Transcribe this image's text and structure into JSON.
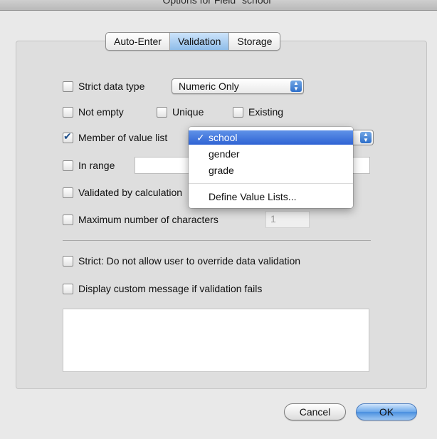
{
  "window": {
    "title": "Options for Field \"school\""
  },
  "tabs": [
    {
      "label": "Auto-Enter"
    },
    {
      "label": "Validation"
    },
    {
      "label": "Storage"
    }
  ],
  "validation": {
    "strict_type": {
      "label": "Strict data type",
      "checked": false,
      "value": "Numeric Only"
    },
    "not_empty": {
      "label": "Not empty",
      "checked": false
    },
    "unique": {
      "label": "Unique",
      "checked": false
    },
    "existing": {
      "label": "Existing",
      "checked": false
    },
    "member_of": {
      "label": "Member of value list",
      "checked": true
    },
    "in_range": {
      "label": "In range",
      "checked": false
    },
    "calculation": {
      "label": "Validated by calculation",
      "checked": false
    },
    "max_chars": {
      "label": "Maximum number of characters",
      "checked": false,
      "value": "1"
    },
    "strict_override": {
      "label": "Strict:  Do not allow user to override data validation",
      "checked": false
    },
    "custom_message": {
      "label": "Display custom message if validation fails",
      "checked": false
    }
  },
  "value_list_menu": {
    "check": "✓",
    "items": [
      "school",
      "gender",
      "grade"
    ],
    "selected": "school",
    "define": "Define Value Lists..."
  },
  "buttons": {
    "cancel": "Cancel",
    "ok": "OK"
  }
}
